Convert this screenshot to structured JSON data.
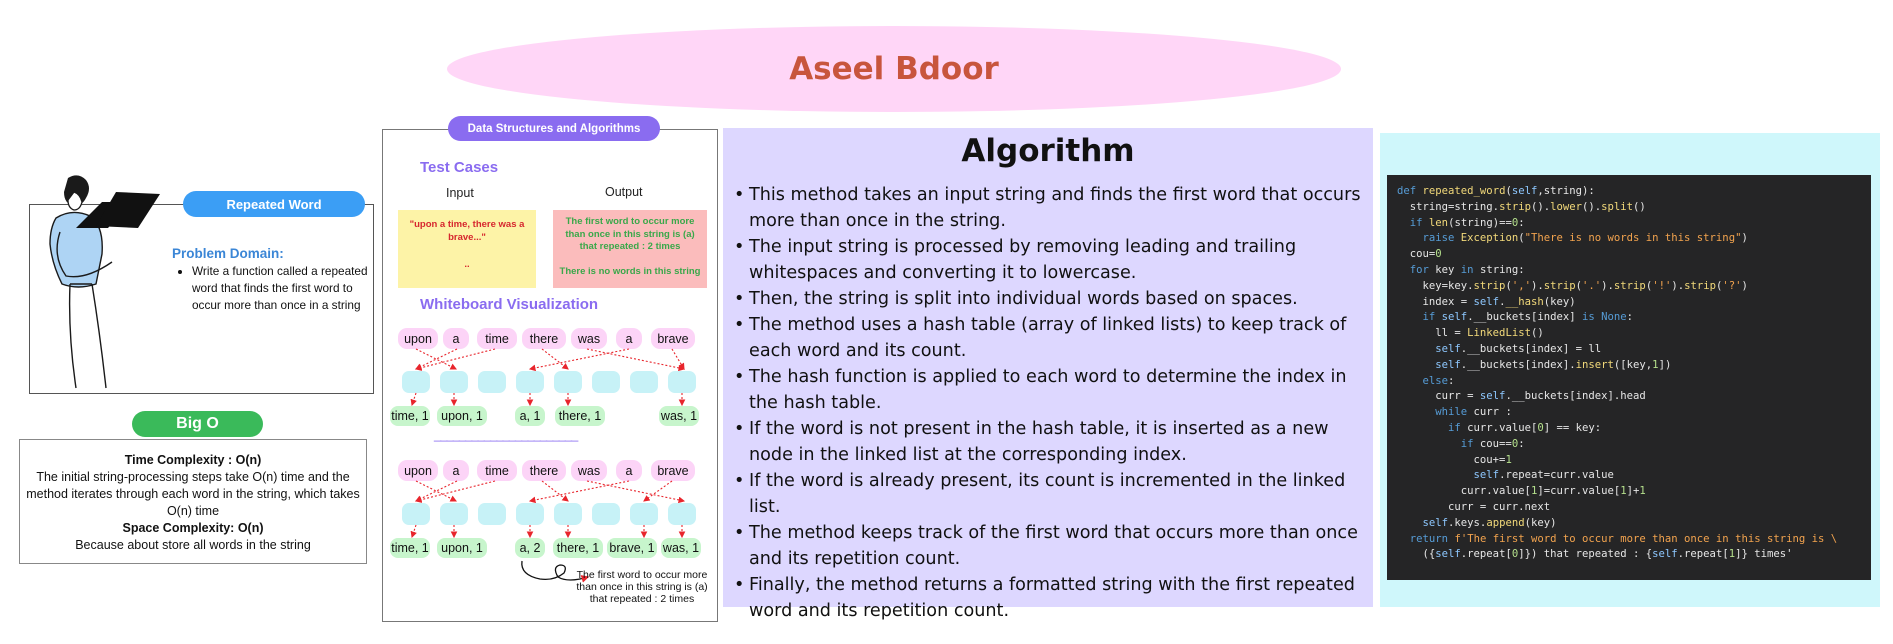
{
  "header": {
    "title": "Aseel Bdoor"
  },
  "problem": {
    "pill": "Repeated Word",
    "domain_title": "Problem Domain:",
    "domain_text": "Write a function called a repeated word that finds the first word to occur more than once in a string"
  },
  "big_o": {
    "pill": "Big O",
    "time_title": "Time Complexity : O(n)",
    "time_text": "The initial string-processing steps take O(n) time and the method iterates through each word in the string, which takes O(n) time",
    "space_title": "Space Complexity: O(n)",
    "space_text": "Because about store all words in the string"
  },
  "whiteboard": {
    "pill": "Data Structures and Algorithms",
    "test_cases_title": "Test Cases",
    "input_header": "Input",
    "output_header": "Output",
    "input_case_1": "\"upon a time, there was a brave...\"",
    "input_case_2": "..",
    "output_case_1": "The first word to occur more than once in this string is (a) that repeated : 2 times",
    "output_case_2": "There is no words in this string",
    "viz_title": "Whiteboard Visualization",
    "row1_words": [
      "upon",
      "a",
      "time",
      "there",
      "was",
      "a",
      "brave"
    ],
    "row1_counts": [
      "time, 1",
      "upon, 1",
      "a, 1",
      "there, 1",
      "was, 1"
    ],
    "divider": "_______________________",
    "row2_words": [
      "upon",
      "a",
      "time",
      "there",
      "was",
      "a",
      "brave"
    ],
    "row2_counts": [
      "time, 1",
      "upon, 1",
      "a, 2",
      "there, 1",
      "brave, 1",
      "was, 1"
    ],
    "note": "The first word to occur more than once in this string is (a) that repeated : 2 times"
  },
  "algorithm": {
    "title": "Algorithm",
    "steps": [
      "This method takes an input string and finds the first word that occurs more than once in the string.",
      "The input string is processed by removing leading and trailing whitespaces and converting it to lowercase.",
      "Then, the string is split into individual words based on spaces.",
      "The method uses a hash table (array of linked lists) to keep track of each word and its count.",
      "The hash function is applied to each word to determine the index in the hash table.",
      "If the word is not present in the hash table, it is inserted as a new node in the linked list at the corresponding index.",
      "If the word is already present, its count is incremented in the linked list.",
      "The method keeps track of the first word that occurs more than once and its repetition count.",
      "Finally, the method returns a formatted string with the first repeated word and its repetition count."
    ]
  },
  "code": {
    "lines": [
      "def repeated_word(self,string):",
      "  string=string.strip().lower().split()",
      "  if len(string)==0:",
      "    raise Exception(\"There is no words in this string\")",
      "  cou=0",
      "  for key in string:",
      "    key=key.strip(',').strip('.').strip('!').strip('?')",
      "    index = self.__hash(key)",
      "    if self.__buckets[index] is None:",
      "      ll = LinkedList()",
      "      self.__buckets[index] = ll",
      "      self.__buckets[index].insert([key,1])",
      "    else:",
      "      curr = self.__buckets[index].head",
      "      while curr :",
      "        if curr.value[0] == key:",
      "          if cou==0:",
      "            cou+=1",
      "            self.repeat=curr.value",
      "          curr.value[1]=curr.value[1]+1",
      "        curr = curr.next",
      "    self.keys.append(key)",
      "  return f'The first word to occur more than once in this string is \\",
      "    ({self.repeat[0]}) that repeated : {self.repeat[1]} times'"
    ]
  },
  "colors": {
    "title_ellipse": "#ffd6f7",
    "title_text": "#c8553d",
    "repeated_word_pill": "#3b9ef5",
    "big_o_pill": "#3aba5a",
    "dsa_pill": "#8a6cf0",
    "algorithm_bg": "#ddd7ff",
    "code_outer_bg": "#cff7fb",
    "code_bg": "#252526"
  },
  "icons": {
    "person": "person-with-laptop-illustration"
  }
}
